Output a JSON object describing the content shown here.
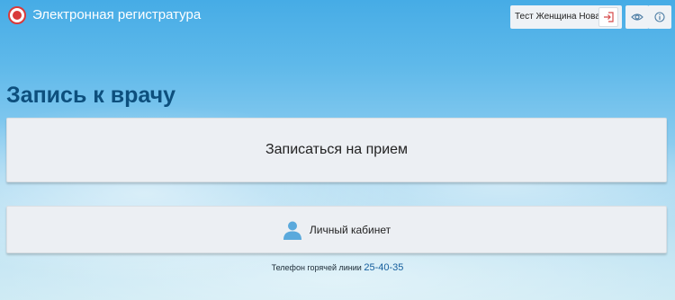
{
  "header": {
    "app_title": "Электронная регистратура",
    "user_name": "Тест Женщина Новая"
  },
  "icons": {
    "logo": "registry-logo-icon",
    "logout": "logout-icon",
    "visibility": "eye-icon",
    "info": "info-icon",
    "person": "person-icon"
  },
  "colors": {
    "logo": "#d93a3a",
    "title": "#0d4f7d",
    "phone": "#155e9d",
    "person_icon": "#5aa9dc"
  },
  "main": {
    "title": "Запись к врачу",
    "appointment_button": "Записаться на прием",
    "cabinet_button": "Личный кабинет"
  },
  "footer": {
    "hotline_label": "Телефон горячей линии",
    "hotline_number": "25-40-35"
  }
}
